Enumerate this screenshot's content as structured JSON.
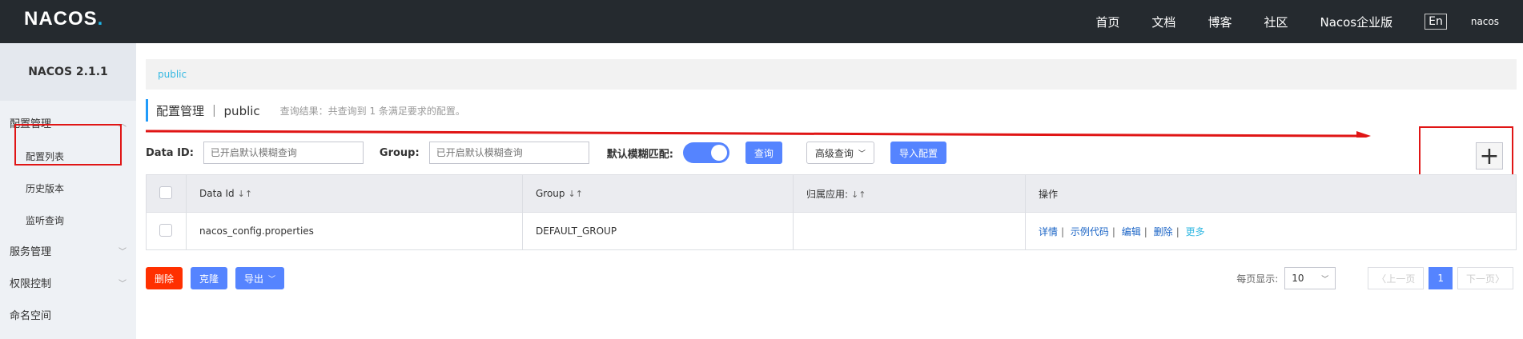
{
  "header": {
    "logo_main": "NACOS",
    "logo_dot": ".",
    "nav": [
      "首页",
      "文档",
      "博客",
      "社区",
      "Nacos企业版"
    ],
    "lang_label": "En",
    "user": "nacos"
  },
  "sidebar": {
    "version": "NACOS 2.1.1",
    "groups": [
      {
        "label": "配置管理",
        "chevron": "︿"
      },
      {
        "label": "服务管理",
        "chevron": "﹀"
      },
      {
        "label": "权限控制",
        "chevron": "﹀"
      },
      {
        "label": "命名空间",
        "chevron": ""
      }
    ],
    "config_items": [
      "配置列表",
      "历史版本",
      "监听查询"
    ]
  },
  "main": {
    "namespace_link": "public",
    "page_title": "配置管理 ｜ public",
    "query_result": "查询结果：共查询到 1 条满足要求的配置。",
    "filter": {
      "data_id_label": "Data ID:",
      "data_id_placeholder": "已开启默认模糊查询",
      "group_label": "Group:",
      "group_placeholder": "已开启默认模糊查询",
      "fuzzy_label": "默认模糊匹配:",
      "fuzzy_on": true,
      "query_btn": "查询",
      "advanced_btn": "高级查询",
      "import_btn": "导入配置"
    },
    "table": {
      "headers": [
        "Data Id",
        "Group",
        "归属应用:",
        "操作"
      ],
      "sort_icon": "↓↑",
      "rows": [
        {
          "data_id": "nacos_config.properties",
          "group": "DEFAULT_GROUP",
          "app": ""
        }
      ],
      "ops": [
        "详情",
        "示例代码",
        "编辑",
        "删除",
        "更多"
      ]
    },
    "bottom": {
      "delete_btn": "删除",
      "clone_btn": "克隆",
      "export_btn": "导出"
    },
    "pager": {
      "per_page_label": "每页显示:",
      "per_page_value": "10",
      "prev": "上一页",
      "next": "下一页",
      "current": "1"
    }
  },
  "colors": {
    "accent": "#5584ff",
    "annotation_red": "#e01515",
    "topbar": "#252a2f"
  }
}
